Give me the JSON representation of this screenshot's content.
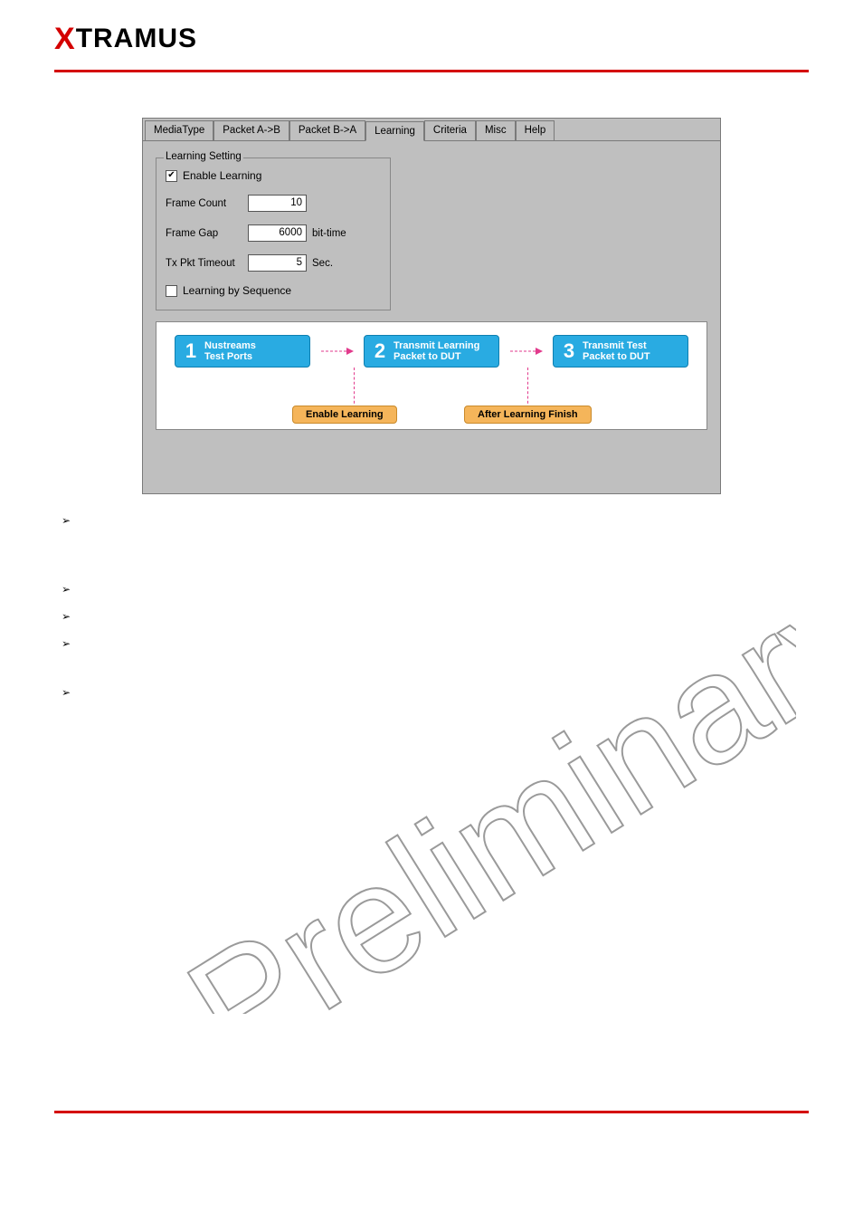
{
  "logo": {
    "x": "X",
    "rest": "TRAMUS"
  },
  "tabs": {
    "mediatype": "MediaType",
    "packetab": "Packet A->B",
    "packetba": "Packet B->A",
    "learning": "Learning",
    "criteria": "Criteria",
    "misc": "Misc",
    "help": "Help"
  },
  "group": {
    "title": "Learning Setting",
    "enable_label": "Enable Learning",
    "enable_checked": "✔",
    "framecount_label": "Frame Count",
    "framecount_value": "10",
    "framegap_label": "Frame Gap",
    "framegap_value": "6000",
    "framegap_unit": "bit-time",
    "txpkt_label": "Tx Pkt Timeout",
    "txpkt_value": "5",
    "txpkt_unit": "Sec.",
    "learnseq_label": "Learning by Sequence"
  },
  "flow": {
    "step1_line1": "Nustreams",
    "step1_line2": "Test Ports",
    "step2_line1": "Transmit Learning",
    "step2_line2": "Packet to DUT",
    "step3_line1": "Transmit Test",
    "step3_line2": "Packet to DUT",
    "btn1": "Enable Learning",
    "btn2": "After Learning Finish"
  },
  "watermark": "Preliminary"
}
